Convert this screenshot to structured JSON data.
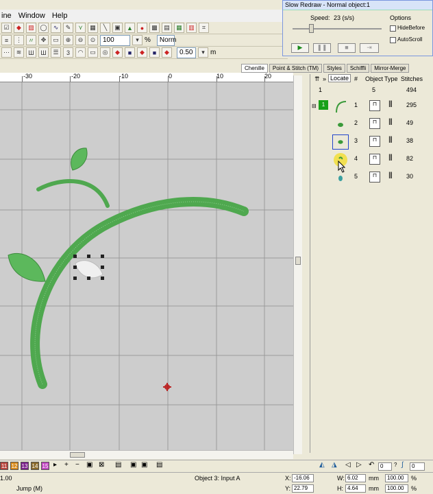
{
  "menu": {
    "items": [
      "ine",
      "Window",
      "Help"
    ]
  },
  "toolbar": {
    "zoom_value": "100",
    "zoom_unit": "%",
    "norm_label": "Norm",
    "step_value": "0.50",
    "step_unit": "m"
  },
  "tabs": [
    "Chenille",
    "Point & Stitch (TM)",
    "Styles",
    "Schiffli",
    "Mirror-Merge"
  ],
  "ruler": {
    "labels": [
      "-30",
      "-20",
      "-10",
      "0",
      "10",
      "20"
    ]
  },
  "object_panel": {
    "locate_label": "Locate",
    "headers": {
      "num": "#",
      "object": "Object",
      "type": "Type",
      "stitches": "Stitches"
    },
    "summary": {
      "group": "1",
      "count": "5",
      "total": "494"
    },
    "group_label": "1",
    "rows": [
      {
        "num": "1",
        "stitches": "295"
      },
      {
        "num": "2",
        "stitches": "49"
      },
      {
        "num": "3",
        "stitches": "38"
      },
      {
        "num": "4",
        "stitches": "82"
      },
      {
        "num": "5",
        "stitches": "30"
      }
    ]
  },
  "slow_redraw": {
    "title": "Slow Redraw - Normal object:1",
    "speed_label": "Speed:",
    "speed_value": "23 (s/s)",
    "options_label": "Options",
    "hide_before": "HideBefore",
    "auto_scroll": "AutoScroll"
  },
  "bottom": {
    "colors": [
      {
        "n": "11",
        "c": "#b8453b"
      },
      {
        "n": "12",
        "c": "#d88a1a"
      },
      {
        "n": "13",
        "c": "#7b1f8a"
      },
      {
        "n": "14",
        "c": "#8a6a2a"
      },
      {
        "n": "15",
        "c": "#c044c0"
      }
    ],
    "fields": [
      "0",
      "0"
    ]
  },
  "status": {
    "left_top": "1.00",
    "left_bottom": "Jump (M)",
    "object_info": "Object 3: Input A",
    "x_label": "X:",
    "x_value": "-16.06",
    "y_label": "Y:",
    "y_value": "22.79",
    "w_label": "W:",
    "w_value": "6.02",
    "h_label": "H:",
    "h_value": "4.64",
    "unit": "mm",
    "w_pct": "100.00",
    "h_pct": "100.00",
    "pct": "%"
  }
}
